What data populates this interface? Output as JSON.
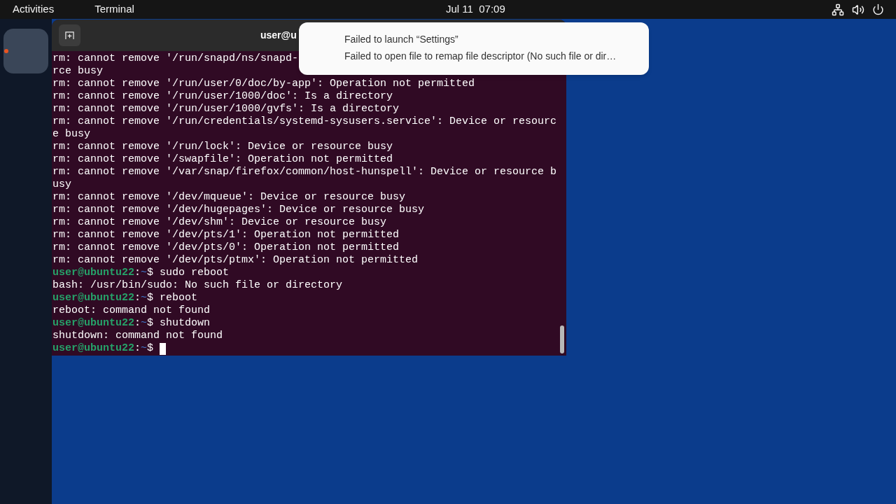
{
  "top_bar": {
    "activities": "Activities",
    "app_menu": "Terminal",
    "clock": "Jul 11  07:09"
  },
  "dock": {
    "apps": [
      {
        "running": true
      }
    ]
  },
  "terminal": {
    "title": "user@u",
    "lines": [
      {
        "kind": "output",
        "text": "rm: cannot remove '/run/snapd/ns/snapd-"
      },
      {
        "kind": "output",
        "text": "rce busy"
      },
      {
        "kind": "output",
        "text": "rm: cannot remove '/run/user/0/doc/by-app': Operation not permitted"
      },
      {
        "kind": "output",
        "text": "rm: cannot remove '/run/user/1000/doc': Is a directory"
      },
      {
        "kind": "output",
        "text": "rm: cannot remove '/run/user/1000/gvfs': Is a directory"
      },
      {
        "kind": "output",
        "text": "rm: cannot remove '/run/credentials/systemd-sysusers.service': Device or resourc"
      },
      {
        "kind": "output",
        "text": "e busy"
      },
      {
        "kind": "output",
        "text": "rm: cannot remove '/run/lock': Device or resource busy"
      },
      {
        "kind": "output",
        "text": "rm: cannot remove '/swapfile': Operation not permitted"
      },
      {
        "kind": "output",
        "text": "rm: cannot remove '/var/snap/firefox/common/host-hunspell': Device or resource b"
      },
      {
        "kind": "output",
        "text": "usy"
      },
      {
        "kind": "output",
        "text": "rm: cannot remove '/dev/mqueue': Device or resource busy"
      },
      {
        "kind": "output",
        "text": "rm: cannot remove '/dev/hugepages': Device or resource busy"
      },
      {
        "kind": "output",
        "text": "rm: cannot remove '/dev/shm': Device or resource busy"
      },
      {
        "kind": "output",
        "text": "rm: cannot remove '/dev/pts/1': Operation not permitted"
      },
      {
        "kind": "output",
        "text": "rm: cannot remove '/dev/pts/0': Operation not permitted"
      },
      {
        "kind": "output",
        "text": "rm: cannot remove '/dev/pts/ptmx': Operation not permitted"
      },
      {
        "kind": "prompt",
        "user": "user@ubuntu22",
        "separator": ":",
        "path": "~",
        "symbol": "$",
        "command": "sudo reboot",
        "cursor": false
      },
      {
        "kind": "output",
        "text": "bash: /usr/bin/sudo: No such file or directory"
      },
      {
        "kind": "prompt",
        "user": "user@ubuntu22",
        "separator": ":",
        "path": "~",
        "symbol": "$",
        "command": "reboot",
        "cursor": false
      },
      {
        "kind": "output",
        "text": "reboot: command not found"
      },
      {
        "kind": "prompt",
        "user": "user@ubuntu22",
        "separator": ":",
        "path": "~",
        "symbol": "$",
        "command": "shutdown",
        "cursor": false
      },
      {
        "kind": "output",
        "text": "shutdown: command not found"
      },
      {
        "kind": "prompt",
        "user": "user@ubuntu22",
        "separator": ":",
        "path": "~",
        "symbol": "$",
        "cursor": true
      }
    ]
  },
  "notification": {
    "title": "Failed to launch “Settings”",
    "body": "Failed to open file to remap file descriptor (No such file or dir…"
  }
}
